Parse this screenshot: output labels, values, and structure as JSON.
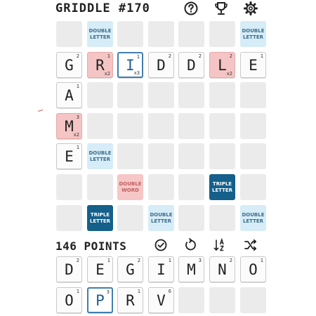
{
  "header": {
    "title": "GRIDDLE #170",
    "icons": [
      "help-icon",
      "trophy-icon",
      "settings-icon"
    ]
  },
  "bonus_labels": {
    "dl": "DOUBLE\nLETTER",
    "dw": "DOUBLE\nWORD",
    "tl": "TRIPLE\nLETTER"
  },
  "colors": {
    "empty": "#ebebeb",
    "double_letter": "#d6ecf7",
    "double_word": "#f7c6c6",
    "triple_letter": "#14608a",
    "red_tile": "#f5c4c4",
    "selected_tile_border": "#3f7fae"
  },
  "board": [
    [
      {
        "t": "e"
      },
      {
        "t": "dl"
      },
      {
        "t": "e"
      },
      {
        "t": "e"
      },
      {
        "t": "e"
      },
      {
        "t": "e"
      },
      {
        "t": "dl"
      }
    ],
    [
      {
        "t": "tile",
        "l": "G",
        "p": "2"
      },
      {
        "t": "tile",
        "l": "R",
        "p": "1",
        "m": "x2",
        "red": true
      },
      {
        "t": "tile",
        "l": "I",
        "p": "1",
        "m": "x3",
        "red": true,
        "sel": true
      },
      {
        "t": "tile",
        "l": "D",
        "p": "2"
      },
      {
        "t": "tile",
        "l": "D",
        "p": "2"
      },
      {
        "t": "tile",
        "l": "L",
        "p": "2",
        "m": "x2",
        "red": true
      },
      {
        "t": "tile",
        "l": "E",
        "p": "1"
      }
    ],
    [
      {
        "t": "tile",
        "l": "A",
        "p": "1"
      },
      {
        "t": "e"
      },
      {
        "t": "e"
      },
      {
        "t": "e"
      },
      {
        "t": "e"
      },
      {
        "t": "e"
      },
      {
        "t": "e"
      }
    ],
    [
      {
        "t": "tile",
        "l": "M",
        "p": "3",
        "m": "x2",
        "red": true
      },
      {
        "t": "e"
      },
      {
        "t": "e"
      },
      {
        "t": "e"
      },
      {
        "t": "e"
      },
      {
        "t": "e"
      },
      {
        "t": "e"
      }
    ],
    [
      {
        "t": "tile",
        "l": "E",
        "p": "1"
      },
      {
        "t": "dl"
      },
      {
        "t": "e"
      },
      {
        "t": "e"
      },
      {
        "t": "e"
      },
      {
        "t": "e"
      },
      {
        "t": "e"
      }
    ],
    [
      {
        "t": "e"
      },
      {
        "t": "e"
      },
      {
        "t": "dw"
      },
      {
        "t": "e"
      },
      {
        "t": "e"
      },
      {
        "t": "tl"
      },
      {
        "t": "e"
      }
    ],
    [
      {
        "t": "e"
      },
      {
        "t": "tl"
      },
      {
        "t": "e"
      },
      {
        "t": "dl"
      },
      {
        "t": "e"
      },
      {
        "t": "e"
      },
      {
        "t": "dl"
      }
    ]
  ],
  "score": {
    "text": "146 POINTS",
    "actions": [
      "submit-check-icon",
      "reset-icon",
      "sort-az-icon",
      "shuffle-icon"
    ]
  },
  "rack": [
    [
      {
        "l": "D",
        "p": "2"
      },
      {
        "l": "E",
        "p": "1"
      },
      {
        "l": "G",
        "p": "2"
      },
      {
        "l": "I",
        "p": "1"
      },
      {
        "l": "M",
        "p": "3"
      },
      {
        "l": "N",
        "p": "2"
      },
      {
        "l": "O",
        "p": "1"
      }
    ],
    [
      {
        "l": "O",
        "p": "1"
      },
      {
        "l": "P",
        "p": "3",
        "sel": true
      },
      {
        "l": "R",
        "p": "1"
      },
      {
        "l": "V",
        "p": "6"
      },
      {},
      {},
      {}
    ]
  ]
}
